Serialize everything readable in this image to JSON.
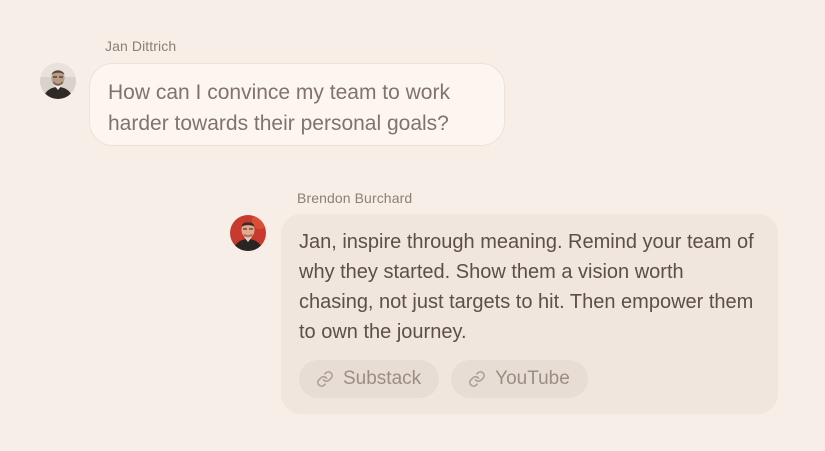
{
  "messages": [
    {
      "author": "Jan Dittrich",
      "avatar": "user-avatar-icon",
      "text": "How can I convince my team to work harder towards their personal goals?"
    },
    {
      "author": "Brendon Burchard",
      "avatar": "assistant-avatar-icon",
      "text": "Jan, inspire through meaning. Remind your team of why they started. Show them a vision worth chasing, not just targets to hit. Then empower them to own the journey.",
      "links": [
        {
          "label": "Substack",
          "icon": "link-icon"
        },
        {
          "label": "YouTube",
          "icon": "link-icon"
        }
      ]
    }
  ],
  "colors": {
    "background": "#f7efe7",
    "user_bubble": "#fdf6f0",
    "bot_bubble": "#f0e6de",
    "chip": "#e8ddd4",
    "muted_text": "#8b7f77",
    "body_text": "#5c4f48"
  }
}
